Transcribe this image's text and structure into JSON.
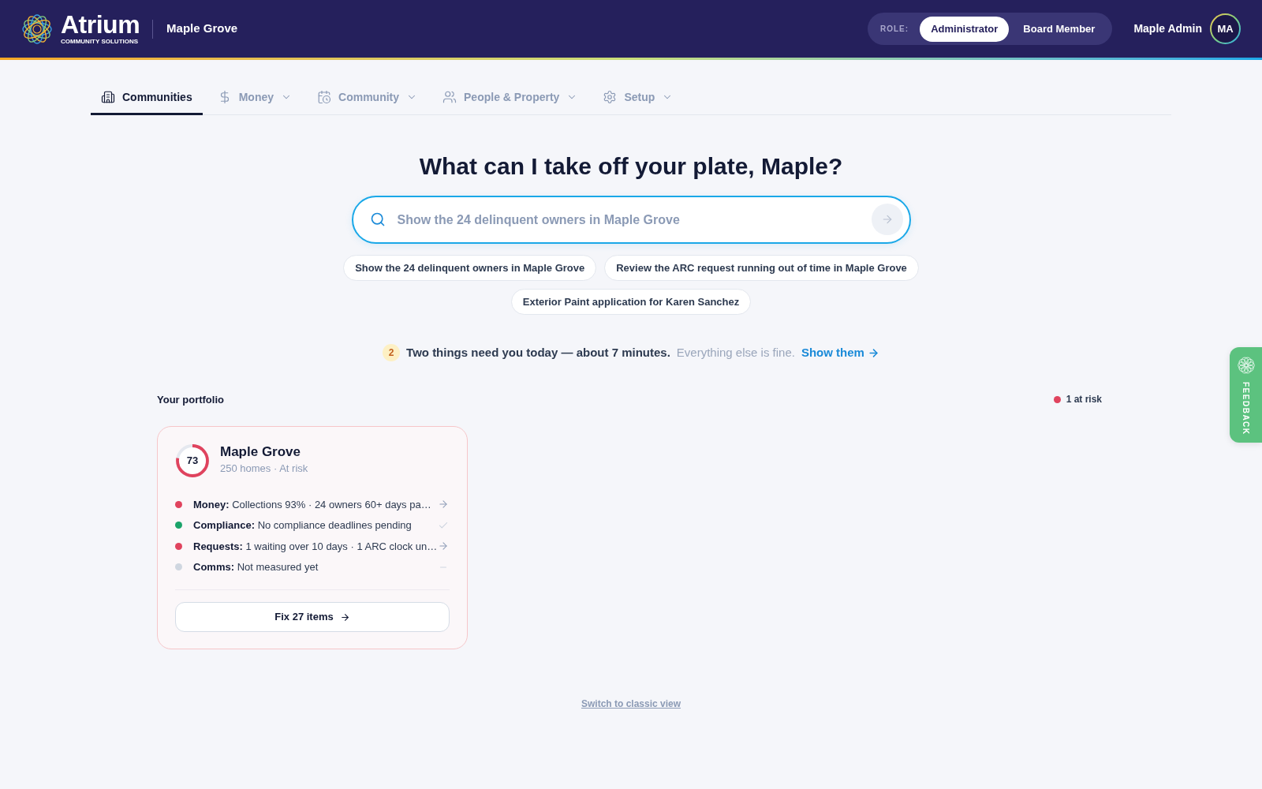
{
  "header": {
    "brand": {
      "name": "Atrium",
      "tagline": "COMMUNITY SOLUTIONS"
    },
    "community": "Maple Grove",
    "role_switch": {
      "label": "ROLE:",
      "options": [
        {
          "label": "Administrator",
          "selected": true
        },
        {
          "label": "Board Member",
          "selected": false
        }
      ]
    },
    "user": {
      "name": "Maple Admin",
      "initials": "MA"
    }
  },
  "nav": {
    "tabs": [
      {
        "label": "Communities",
        "selected": true,
        "has_menu": false
      },
      {
        "label": "Money",
        "selected": false,
        "has_menu": true
      },
      {
        "label": "Community",
        "selected": false,
        "has_menu": true
      },
      {
        "label": "People & Property",
        "selected": false,
        "has_menu": true
      },
      {
        "label": "Setup",
        "selected": false,
        "has_menu": true
      }
    ]
  },
  "assistant": {
    "heading": "What can I take off your plate, Maple?",
    "search": {
      "placeholder": "Show the 24 delinquent owners in Maple Grove",
      "submit_disabled": true
    },
    "suggestions": [
      "Show the 24 delinquent owners in Maple Grove",
      "Review the ARC request running out of time in Maple Grove",
      "Exterior Paint application for Karen Sanchez"
    ]
  },
  "alert": {
    "count": "2",
    "message": "Two things need you today — about 7 minutes.",
    "note": "Everything else is fine.",
    "link": "Show them"
  },
  "portfolio": {
    "title": "Your portfolio",
    "risk_summary": {
      "label": "1 at risk",
      "color": "#e0435e"
    },
    "cards": [
      {
        "name": "Maple Grove",
        "score": "73",
        "level": 0.78,
        "color": "#e0435e",
        "subtitle": "250 homes · At risk",
        "metrics": [
          {
            "label": "Money:",
            "text": "Collections 93% · 24 owners 60+ days pa…",
            "color": "#e0435e",
            "kind": "arrow"
          },
          {
            "label": "Compliance:",
            "text": "No compliance deadlines pending",
            "color": "#1aa36a",
            "kind": "check"
          },
          {
            "label": "Requests:",
            "text": "1 waiting over 10 days · 1 ARC clock un…",
            "color": "#e0435e",
            "kind": "arrow"
          },
          {
            "label": "Comms:",
            "text": "Not measured yet",
            "color": "#cfd6e0",
            "kind": "dash"
          }
        ],
        "action": "Fix 27 items"
      }
    ]
  },
  "footer": {
    "link": "Switch to classic view"
  },
  "feedback": {
    "label": "FEEDBACK"
  }
}
